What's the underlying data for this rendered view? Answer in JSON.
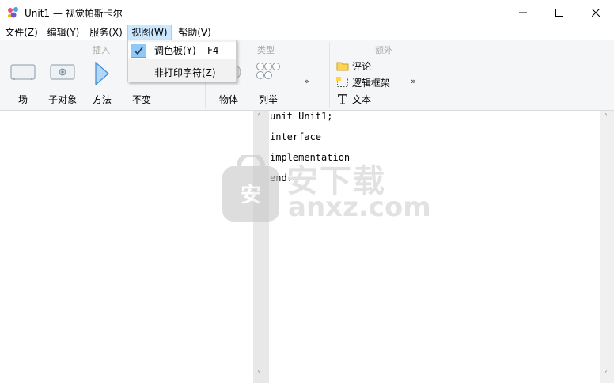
{
  "window": {
    "title": "Unit1 — 视觉帕斯卡尔",
    "controls": {
      "minimize": "minimize",
      "maximize": "maximize",
      "close": "close"
    }
  },
  "menubar": {
    "items": [
      {
        "label": "文件(Z)"
      },
      {
        "label": "编辑(Y)"
      },
      {
        "label": "服务(X)"
      },
      {
        "label": "视图(W)",
        "active": true
      },
      {
        "label": "帮助(V)"
      }
    ]
  },
  "view_menu": {
    "items": [
      {
        "label": "调色板(Y)",
        "shortcut": "F4",
        "checked": true
      },
      {
        "label": "非打印字符(Z)",
        "shortcut": "",
        "checked": false
      }
    ]
  },
  "ribbon": {
    "groups": [
      {
        "label": "插入"
      },
      {
        "label": "类型"
      },
      {
        "label": "额外"
      }
    ],
    "buttons": [
      {
        "label": "场",
        "icon": "field-icon"
      },
      {
        "label": "子对象",
        "icon": "subobject-icon"
      },
      {
        "label": "方法",
        "icon": "method-icon"
      },
      {
        "label": "不变",
        "icon": "invariant-icon"
      },
      {
        "label": "物体",
        "icon": "object-icon"
      },
      {
        "label": "列举",
        "icon": "enumeration-icon"
      }
    ],
    "extra": [
      {
        "label": "评论",
        "icon": "comment-icon"
      },
      {
        "label": "逻辑框架",
        "icon": "logic-frame-icon"
      },
      {
        "label": "文本",
        "icon": "text-icon"
      }
    ],
    "expand_glyph": "»"
  },
  "editor": {
    "lines": [
      "unit Unit1;",
      "interface",
      "implementation",
      "end."
    ]
  },
  "watermark": {
    "cn": "安下载",
    "en": "anxz.com",
    "shield_char": "安"
  },
  "colors": {
    "menu_highlight": "#cce8ff",
    "check_bg": "#90c8f6",
    "ribbon_bg": "#f5f6f7"
  }
}
